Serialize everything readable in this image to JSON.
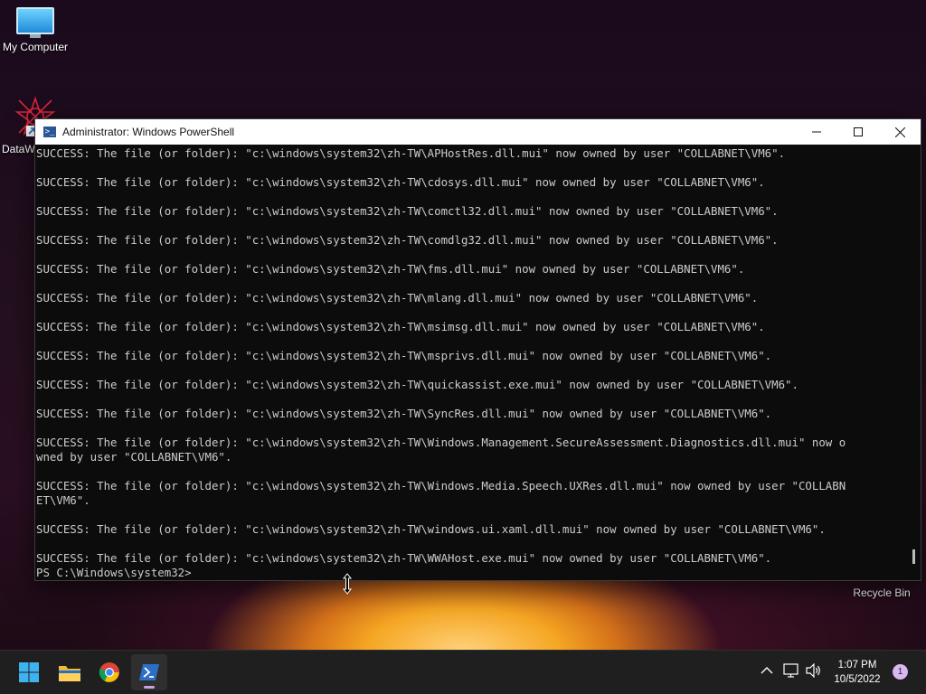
{
  "desktop": {
    "icons": [
      {
        "label": "My Computer"
      },
      {
        "label": "DataW"
      },
      {
        "label": "Recycle Bin"
      }
    ]
  },
  "window": {
    "title": "Administrator: Windows PowerShell",
    "console_lines": [
      "SUCCESS: The file (or folder): \"c:\\windows\\system32\\zh-TW\\APHostRes.dll.mui\" now owned by user \"COLLABNET\\VM6\".",
      "",
      "SUCCESS: The file (or folder): \"c:\\windows\\system32\\zh-TW\\cdosys.dll.mui\" now owned by user \"COLLABNET\\VM6\".",
      "",
      "SUCCESS: The file (or folder): \"c:\\windows\\system32\\zh-TW\\comctl32.dll.mui\" now owned by user \"COLLABNET\\VM6\".",
      "",
      "SUCCESS: The file (or folder): \"c:\\windows\\system32\\zh-TW\\comdlg32.dll.mui\" now owned by user \"COLLABNET\\VM6\".",
      "",
      "SUCCESS: The file (or folder): \"c:\\windows\\system32\\zh-TW\\fms.dll.mui\" now owned by user \"COLLABNET\\VM6\".",
      "",
      "SUCCESS: The file (or folder): \"c:\\windows\\system32\\zh-TW\\mlang.dll.mui\" now owned by user \"COLLABNET\\VM6\".",
      "",
      "SUCCESS: The file (or folder): \"c:\\windows\\system32\\zh-TW\\msimsg.dll.mui\" now owned by user \"COLLABNET\\VM6\".",
      "",
      "SUCCESS: The file (or folder): \"c:\\windows\\system32\\zh-TW\\msprivs.dll.mui\" now owned by user \"COLLABNET\\VM6\".",
      "",
      "SUCCESS: The file (or folder): \"c:\\windows\\system32\\zh-TW\\quickassist.exe.mui\" now owned by user \"COLLABNET\\VM6\".",
      "",
      "SUCCESS: The file (or folder): \"c:\\windows\\system32\\zh-TW\\SyncRes.dll.mui\" now owned by user \"COLLABNET\\VM6\".",
      "",
      "SUCCESS: The file (or folder): \"c:\\windows\\system32\\zh-TW\\Windows.Management.SecureAssessment.Diagnostics.dll.mui\" now o",
      "wned by user \"COLLABNET\\VM6\".",
      "",
      "SUCCESS: The file (or folder): \"c:\\windows\\system32\\zh-TW\\Windows.Media.Speech.UXRes.dll.mui\" now owned by user \"COLLABN",
      "ET\\VM6\".",
      "",
      "SUCCESS: The file (or folder): \"c:\\windows\\system32\\zh-TW\\windows.ui.xaml.dll.mui\" now owned by user \"COLLABNET\\VM6\".",
      "",
      "SUCCESS: The file (or folder): \"c:\\windows\\system32\\zh-TW\\WWAHost.exe.mui\" now owned by user \"COLLABNET\\VM6\".",
      "PS C:\\Windows\\system32>"
    ]
  },
  "taskbar": {
    "apps": [
      {
        "icon": "windows-start-icon"
      },
      {
        "icon": "file-explorer-icon"
      },
      {
        "icon": "chrome-icon"
      },
      {
        "icon": "powershell-icon"
      }
    ],
    "clock_time": "1:07 PM",
    "clock_date": "10/5/2022",
    "notification_count": "1"
  },
  "colors": {
    "console_bg": "#0c0c0c",
    "console_text": "#cccccc",
    "taskbar_bg": "#1f1f1f"
  }
}
